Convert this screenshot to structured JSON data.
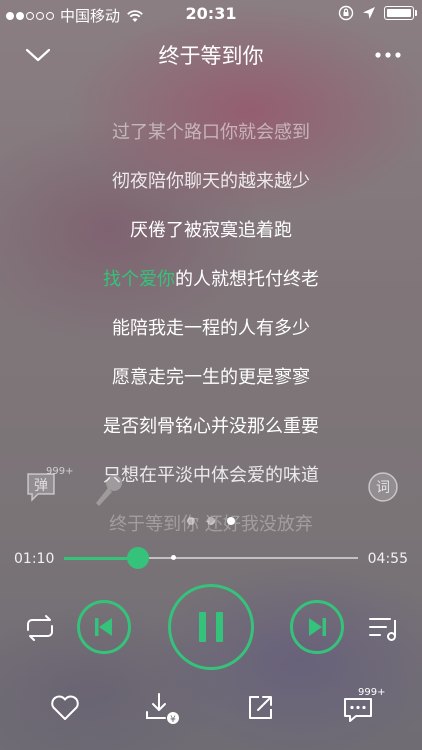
{
  "status_bar": {
    "carrier": "中国移动",
    "time": "20:31",
    "signal_dots_on": 2,
    "signal_dots_total": 5
  },
  "header": {
    "title": "终于等到你"
  },
  "lyrics": {
    "lines": [
      "过了某个路口你就会感到",
      "彻夜陪你聊天的越来越少",
      "厌倦了被寂寞追着跑",
      "找个爱你的人就想托付终老",
      "能陪我走一程的人有多少",
      "愿意走完一生的更是寥寥",
      "是否刻骨铭心并没那么重要",
      "只想在平淡中体会爱的味道",
      "终于等到你 还好我没放弃"
    ],
    "current_sung": "找个爱你",
    "current_rest": "的人就想托付终老"
  },
  "side": {
    "danmu_label": "弹",
    "danmu_count": "999+",
    "lyric_label": "词"
  },
  "progress": {
    "current": "01:10",
    "total": "04:55",
    "played_fraction": 0.253,
    "buffered_fraction": 0.372
  },
  "pager": {
    "pages": 3,
    "active": 2
  },
  "bottom_bar": {
    "comment_count": "999+"
  },
  "colors": {
    "accent": "#35c27a"
  }
}
